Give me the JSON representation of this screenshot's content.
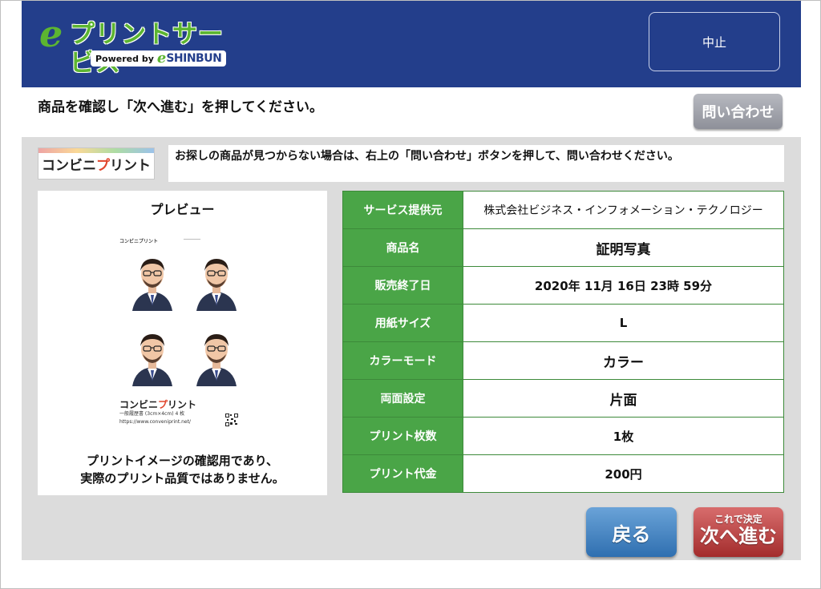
{
  "header": {
    "logo_title": "プリントサービス",
    "logo_e": "e",
    "powered_by": "Powered by",
    "powered_e": "e",
    "powered_brand": "SHINBUN",
    "cancel_label": "中止"
  },
  "instruction": "商品を確認し「次へ進む」を押してください。",
  "inquiry_label": "問い合わせ",
  "service_logo": {
    "part1": "コンビニ",
    "part2": "プ",
    "part3": "リント"
  },
  "notice": "お探しの商品が見つからない場合は、右上の「問い合わせ」ボタンを押して、問い合わせください。",
  "preview": {
    "title": "プレビュー",
    "sheet_brand_a": "コンビニ",
    "sheet_brand_b": "プ",
    "sheet_brand_c": "リント",
    "sheet_sub": "一般履歴書 (3cm×4cm) 4 枚",
    "sheet_url": "https://www.conveniprint.net/",
    "note_line1": "プリントイメージの確認用であり、",
    "note_line2": "実際のプリント品質ではありません。"
  },
  "details": [
    {
      "label": "サービス提供元",
      "value": "株式会社ビジネス・インフォメーション・テクノロジー"
    },
    {
      "label": "商品名",
      "value": "証明写真"
    },
    {
      "label": "販売終了日",
      "value": "2020年 11月 16日 23時 59分"
    },
    {
      "label": "用紙サイズ",
      "value": "L"
    },
    {
      "label": "カラーモード",
      "value": "カラー"
    },
    {
      "label": "両面設定",
      "value": "片面"
    },
    {
      "label": "プリント枚数",
      "value": "1枚"
    },
    {
      "label": "プリント代金",
      "value": "200円"
    }
  ],
  "buttons": {
    "back_label": "戻る",
    "next_small": "これで決定",
    "next_large": "次へ進む"
  },
  "colors": {
    "header_blue": "#233e8b",
    "table_green": "#4aa547",
    "back_blue": "#2f6fb0",
    "next_red": "#a32c2c"
  }
}
